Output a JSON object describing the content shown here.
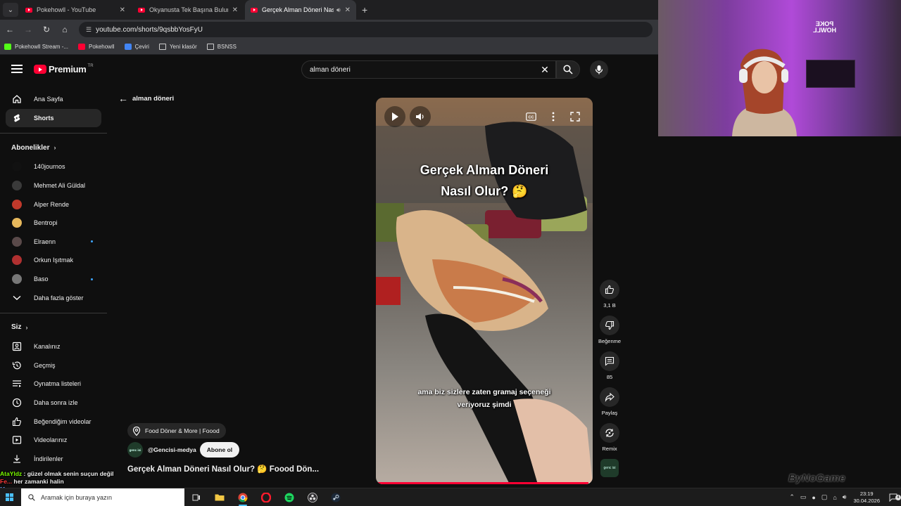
{
  "browser": {
    "tabs": [
      {
        "title": "Pokehowll - YouTube",
        "active": false,
        "audio": false
      },
      {
        "title": "Okyanusta Tek Başına Bulunan",
        "active": false,
        "audio": false
      },
      {
        "title": "Gerçek Alman Döneri Nasıl",
        "active": true,
        "audio": true
      }
    ],
    "url": "youtube.com/shorts/9qsbbYosFyU",
    "bookmarks": [
      {
        "label": "Pokehowll Stream -...",
        "icon": "kick"
      },
      {
        "label": "Pokehowll",
        "icon": "youtube"
      },
      {
        "label": "Çeviri",
        "icon": "translate"
      },
      {
        "label": "Yeni klasör",
        "icon": "folder"
      },
      {
        "label": "BSNSS",
        "icon": "folder"
      }
    ]
  },
  "youtube": {
    "logo_text": "Premium",
    "logo_region": "TR",
    "search_value": "alman döneri",
    "back_label": "alman döneri",
    "sidebar": {
      "main": [
        {
          "label": "Ana Sayfa",
          "icon": "home-icon"
        },
        {
          "label": "Shorts",
          "icon": "shorts-icon",
          "active": true
        }
      ],
      "subs_header": "Abonelikler",
      "subs": [
        {
          "label": "140journos",
          "color": "#111111",
          "live": false
        },
        {
          "label": "Mehmet Ali Güldal",
          "color": "#3a3a3a",
          "live": false
        },
        {
          "label": "Alper Rende",
          "color": "#c0392b",
          "live": false
        },
        {
          "label": "Bentropi",
          "color": "#e6b85c",
          "live": false
        },
        {
          "label": "Elraenn",
          "color": "#5a4a4a",
          "live": true
        },
        {
          "label": "Orkun Işıtmak",
          "color": "#b03030",
          "live": false
        },
        {
          "label": "Baso",
          "color": "#777777",
          "live": true
        }
      ],
      "show_more": "Daha fazla göster",
      "you_header": "Siz",
      "you": [
        {
          "label": "Kanalınız",
          "icon": "channel-icon"
        },
        {
          "label": "Geçmiş",
          "icon": "history-icon"
        },
        {
          "label": "Oynatma listeleri",
          "icon": "playlist-icon"
        },
        {
          "label": "Daha sonra izle",
          "icon": "clock-icon"
        },
        {
          "label": "Beğendiğim videolar",
          "icon": "thumbs-up-icon"
        },
        {
          "label": "Videolarınız",
          "icon": "video-icon"
        },
        {
          "label": "İndirilenler",
          "icon": "download-icon"
        }
      ]
    },
    "short": {
      "overlay_title_line1": "Gerçek Alman Döneri",
      "overlay_title_line2": "Nasıl Olur? 🤔",
      "subtitle_line1": "ama biz sizlere zaten gramaj seçeneği",
      "subtitle_line2": "veriyoruz şimdi",
      "progress": 0.98,
      "location": "Food Döner & More | Foood",
      "channel": "@Gencisi-medya",
      "channel_avatar_text": "genc isi",
      "subscribe": "Abone ol",
      "title": "Gerçek Alman Döneri Nasıl Olur? 🤔 Foood Dön..."
    },
    "actions": {
      "likes": "3,1 B",
      "dislike": "Beğenme",
      "comments": "85",
      "share": "Paylaş",
      "remix": "Remix"
    }
  },
  "webcam": {
    "logo_line1": "POKE",
    "logo_line2": "HOWLL"
  },
  "chat": [
    {
      "name": "AtaYldz",
      "text": "güzel olmak senin suçun değil"
    },
    {
      "name": "Fe...",
      "text": "her zamanki halin"
    },
    {
      "name": "Mo...",
      "text": ""
    }
  ],
  "watermark": "ByNoGame",
  "taskbar": {
    "search_placeholder": "Aramak için buraya yazın",
    "time": "23:19",
    "date": "30.04.2026",
    "notifications": "4"
  }
}
